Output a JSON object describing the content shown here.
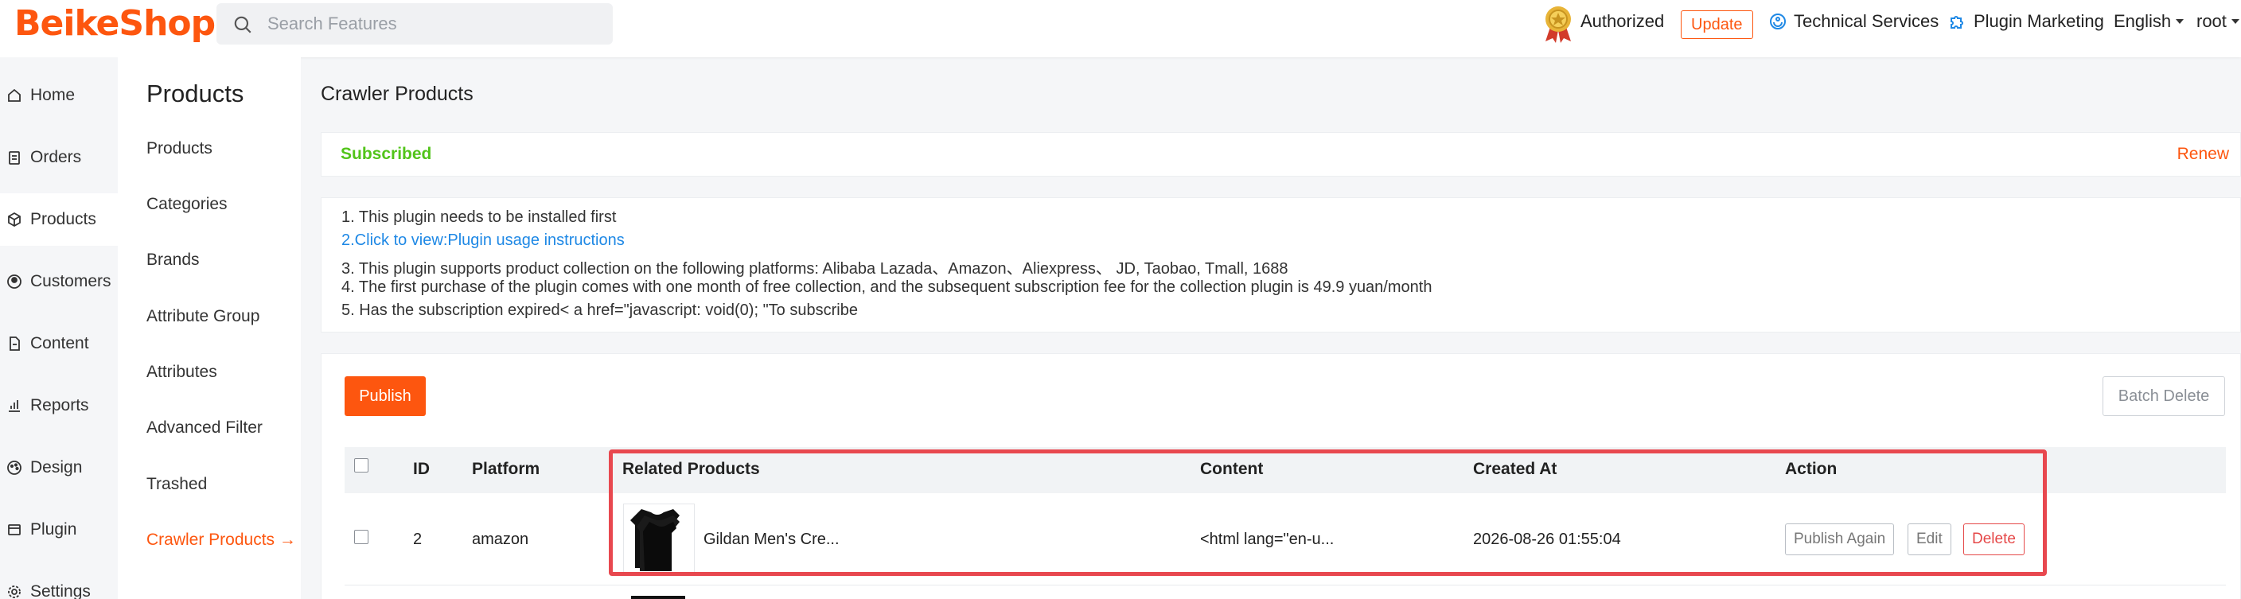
{
  "header": {
    "logo": "BeikeShop",
    "search_placeholder": "Search Features",
    "authorized": "Authorized",
    "update": "Update",
    "technical_services": "Technical Services",
    "plugin_marketing": "Plugin Marketing",
    "language": "English",
    "user": "root"
  },
  "sidebar": {
    "items": [
      {
        "label": "Home",
        "icon": "home-icon"
      },
      {
        "label": "Orders",
        "icon": "clipboard-icon"
      },
      {
        "label": "Products",
        "icon": "box-icon"
      },
      {
        "label": "Customers",
        "icon": "user-circle-icon"
      },
      {
        "label": "Content",
        "icon": "document-icon"
      },
      {
        "label": "Reports",
        "icon": "bar-chart-icon"
      },
      {
        "label": "Design",
        "icon": "palette-icon"
      },
      {
        "label": "Plugin",
        "icon": "plugin-icon"
      },
      {
        "label": "Settings",
        "icon": "gear-icon"
      }
    ]
  },
  "subnav": {
    "title": "Products",
    "items": [
      "Products",
      "Categories",
      "Brands",
      "Attribute Group",
      "Attributes",
      "Advanced Filter",
      "Trashed",
      "Crawler Products →"
    ]
  },
  "main": {
    "title": "Crawler Products",
    "subscription_status": "Subscribed",
    "renew": "Renew",
    "info_lines": [
      "1. This plugin needs to be installed first",
      "2.Click to view:Plugin usage instructions",
      "3. This plugin supports product collection on the following platforms: Alibaba Lazada、Amazon、Aliexpress、 JD, Taobao, Tmall, 1688",
      "4. The first purchase of the plugin comes with one month of free collection, and the subsequent subscription fee for the collection plugin is 49.9 yuan/month",
      "5. Has the subscription expired< a href=\"javascript: void(0); \"To subscribe"
    ],
    "publish": "Publish",
    "batch_delete": "Batch Delete"
  },
  "table": {
    "columns": [
      "ID",
      "Platform",
      "Related Products",
      "Content",
      "Created At",
      "Action"
    ],
    "rows": [
      {
        "id": "2",
        "platform": "amazon",
        "product": "Gildan Men's Cre...",
        "content": "<html lang=\"en-u...",
        "created_at": "2026-08-26 01:55:04",
        "actions": [
          "Publish Again",
          "Edit",
          "Delete"
        ]
      }
    ]
  },
  "colors": {
    "accent": "#fd560f",
    "success": "#52c41a",
    "link": "#1e88e5",
    "danger": "#e54848",
    "highlight": "#e8484f"
  }
}
